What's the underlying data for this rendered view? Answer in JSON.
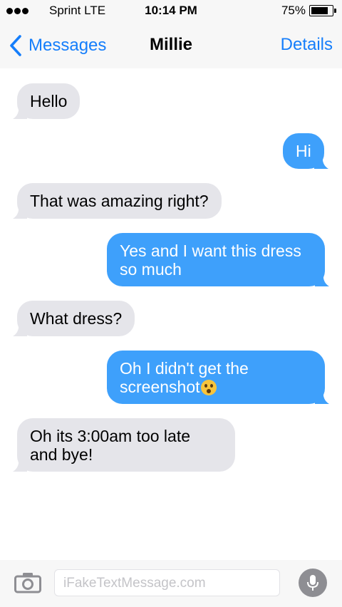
{
  "status_bar": {
    "carrier": "Sprint  LTE",
    "time": "10:14 PM",
    "battery": "75%"
  },
  "nav": {
    "back_label": "Messages",
    "title": "Millie",
    "details_label": "Details"
  },
  "messages": [
    {
      "direction": "incoming",
      "text": "Hello"
    },
    {
      "direction": "outgoing",
      "text": "Hi"
    },
    {
      "direction": "incoming",
      "text": "That was amazing right?"
    },
    {
      "direction": "outgoing",
      "lines": [
        "Yes and I want this dress",
        "so much"
      ]
    },
    {
      "direction": "incoming",
      "text": "What dress?"
    },
    {
      "direction": "outgoing",
      "lines": [
        "Oh I didn't get the",
        "screenshot"
      ],
      "emoji": "hushed-face-emoji"
    },
    {
      "direction": "incoming",
      "lines": [
        "Oh its 3:00am too late",
        "and bye!"
      ]
    }
  ],
  "input": {
    "placeholder": "iFakeTextMessage.com"
  },
  "icons": {
    "back": "chevron-left-icon",
    "camera": "camera-icon",
    "mic": "microphone-icon"
  },
  "colors": {
    "accent": "#157efb",
    "outgoing_bubble": "#3ea0fb",
    "incoming_bubble": "#e5e5ea"
  }
}
